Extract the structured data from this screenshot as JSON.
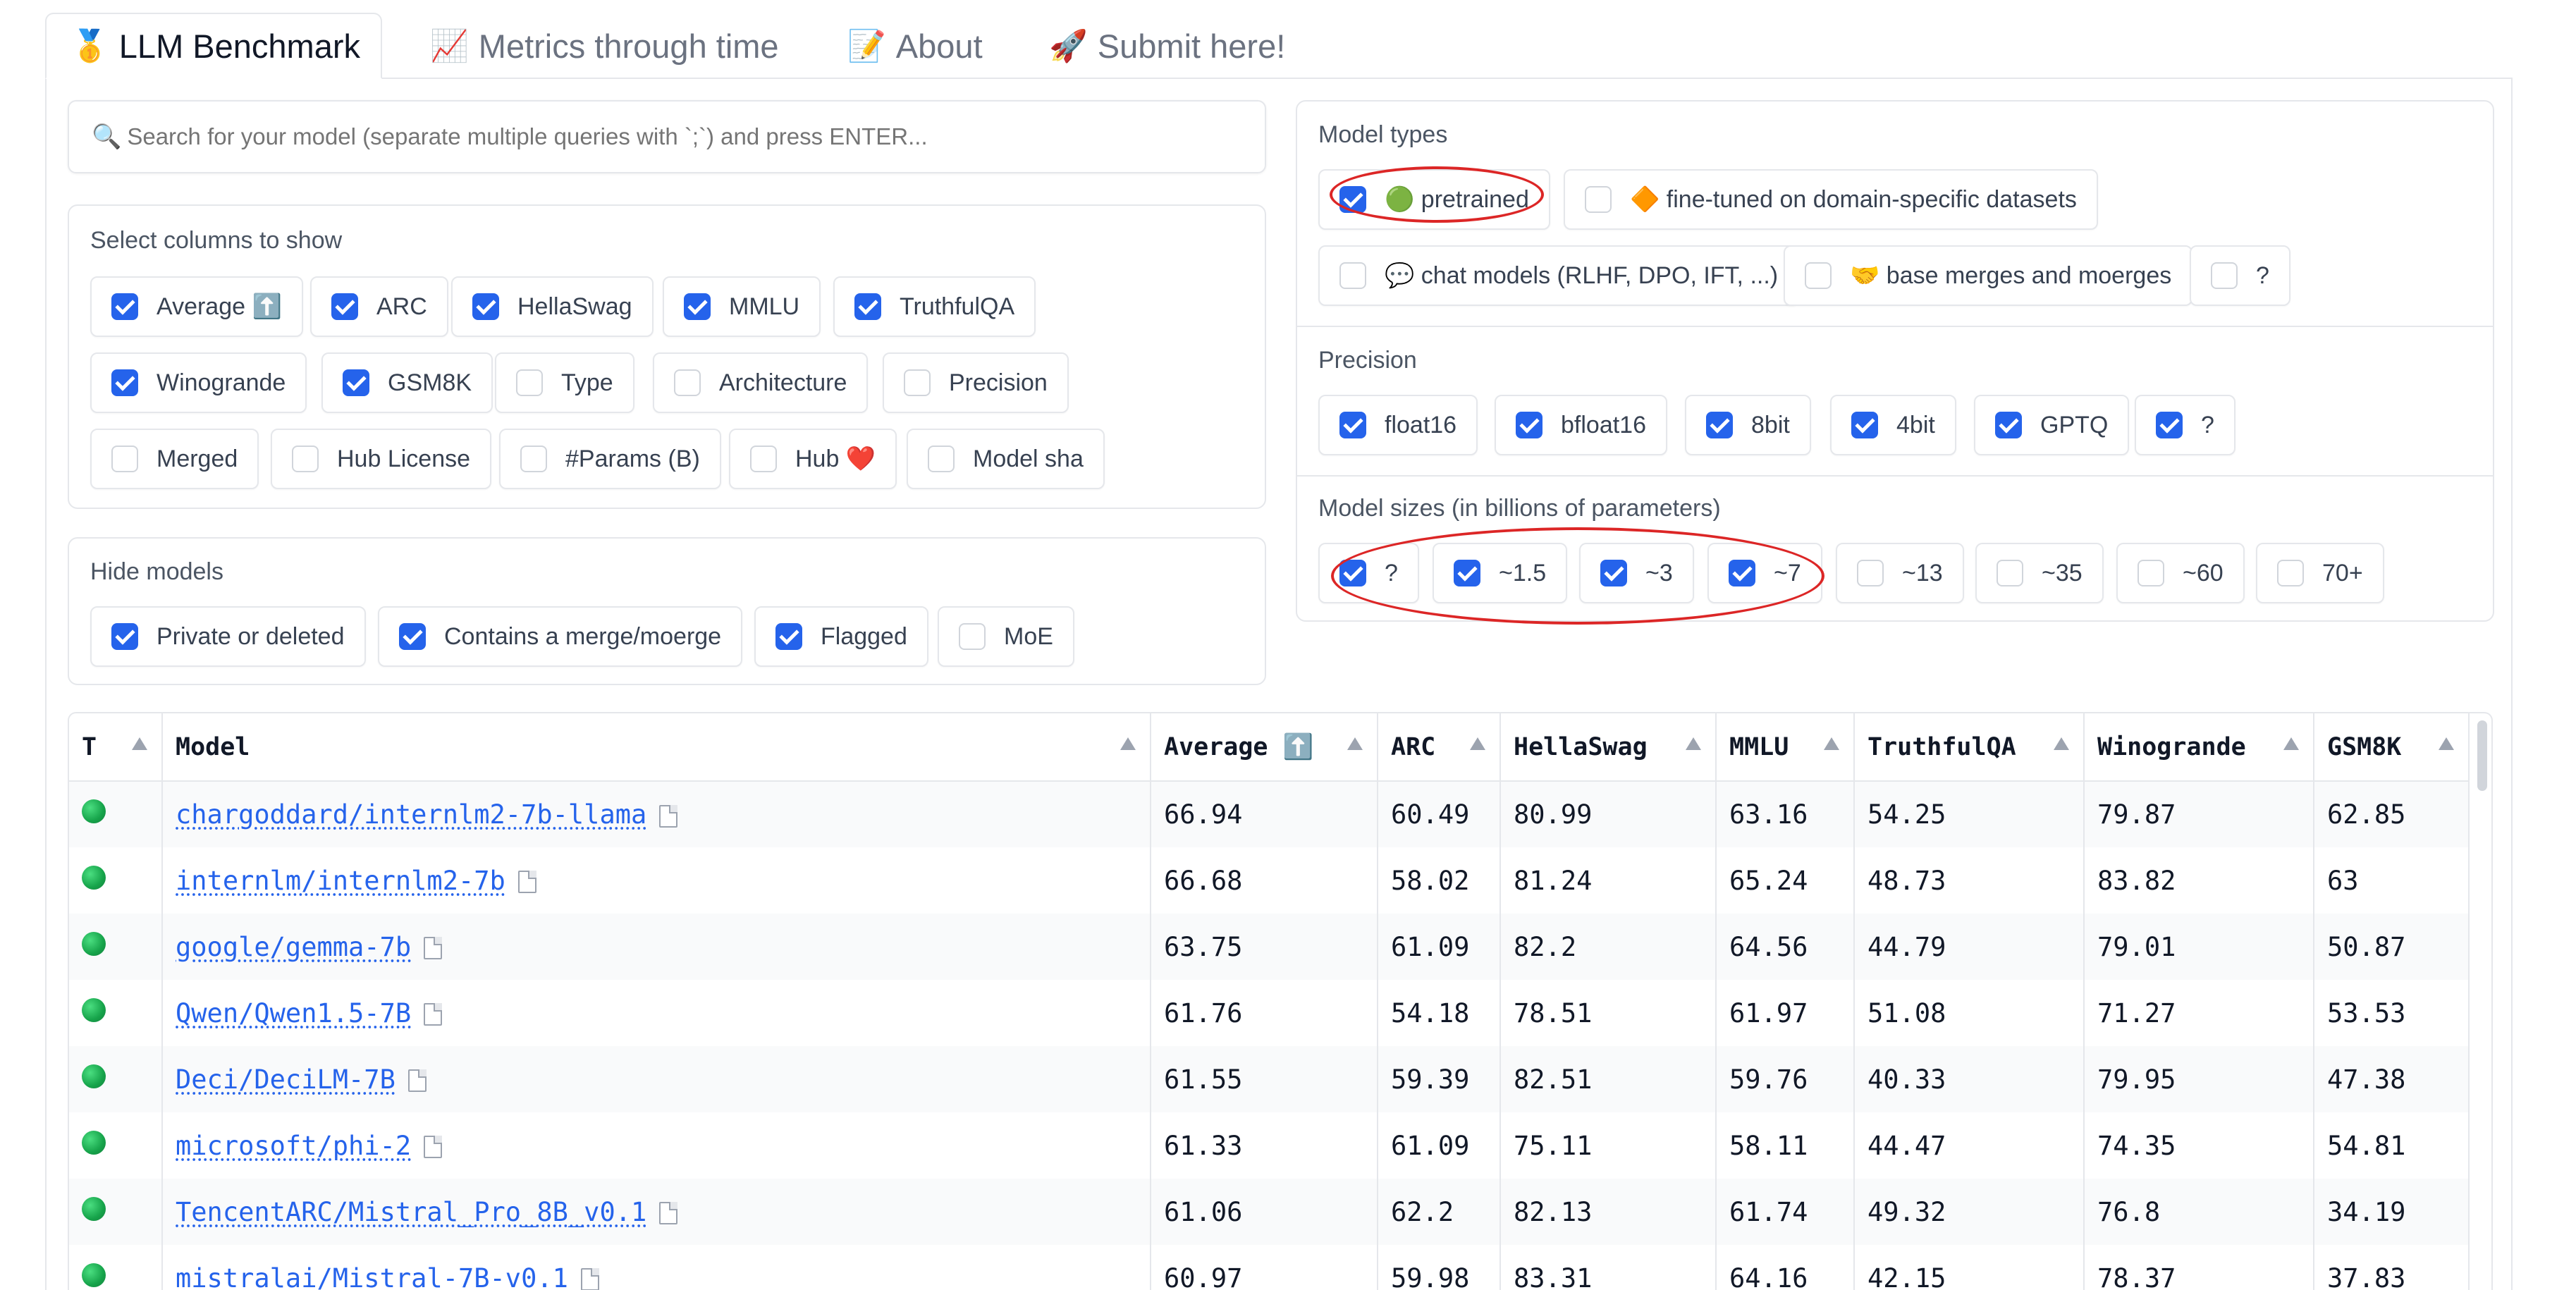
{
  "tabs": [
    {
      "icon": "🥇",
      "label": "LLM Benchmark"
    },
    {
      "icon": "📈",
      "label": "Metrics through time"
    },
    {
      "icon": "📝",
      "label": "About"
    },
    {
      "icon": "🚀",
      "label": "Submit here!"
    }
  ],
  "search": {
    "icon": "🔍",
    "placeholder": "Search for your model (separate multiple queries with `;`) and press ENTER..."
  },
  "columns_panel": {
    "label": "Select columns to show",
    "options": [
      {
        "label": "Average ⬆️",
        "checked": true
      },
      {
        "label": "ARC",
        "checked": true
      },
      {
        "label": "HellaSwag",
        "checked": true
      },
      {
        "label": "MMLU",
        "checked": true
      },
      {
        "label": "TruthfulQA",
        "checked": true
      },
      {
        "label": "Winogrande",
        "checked": true
      },
      {
        "label": "GSM8K",
        "checked": true
      },
      {
        "label": "Type",
        "checked": false
      },
      {
        "label": "Architecture",
        "checked": false
      },
      {
        "label": "Precision",
        "checked": false
      },
      {
        "label": "Merged",
        "checked": false
      },
      {
        "label": "Hub License",
        "checked": false
      },
      {
        "label": "#Params (B)",
        "checked": false
      },
      {
        "label": "Hub ❤️",
        "checked": false
      },
      {
        "label": "Model sha",
        "checked": false
      }
    ]
  },
  "hide_panel": {
    "label": "Hide models",
    "options": [
      {
        "label": "Private or deleted",
        "checked": true
      },
      {
        "label": "Contains a merge/moerge",
        "checked": true
      },
      {
        "label": "Flagged",
        "checked": true
      },
      {
        "label": "MoE",
        "checked": false
      }
    ]
  },
  "model_types": {
    "label": "Model types",
    "options": [
      {
        "label": "🟢 pretrained",
        "checked": true
      },
      {
        "label": "🔶 fine-tuned on domain-specific datasets",
        "checked": false
      },
      {
        "label": "💬 chat models (RLHF, DPO, IFT, ...)",
        "checked": false
      },
      {
        "label": "🤝 base merges and moerges",
        "checked": false
      },
      {
        "label": "?",
        "checked": false
      }
    ]
  },
  "precision": {
    "label": "Precision",
    "options": [
      {
        "label": "float16",
        "checked": true
      },
      {
        "label": "bfloat16",
        "checked": true
      },
      {
        "label": "8bit",
        "checked": true
      },
      {
        "label": "4bit",
        "checked": true
      },
      {
        "label": "GPTQ",
        "checked": true
      },
      {
        "label": "?",
        "checked": true
      }
    ]
  },
  "model_sizes": {
    "label": "Model sizes (in billions of parameters)",
    "options": [
      {
        "label": "?",
        "checked": true
      },
      {
        "label": "~1.5",
        "checked": true
      },
      {
        "label": "~3",
        "checked": true
      },
      {
        "label": "~7",
        "checked": true
      },
      {
        "label": "~13",
        "checked": false
      },
      {
        "label": "~35",
        "checked": false
      },
      {
        "label": "~60",
        "checked": false
      },
      {
        "label": "70+",
        "checked": false
      }
    ]
  },
  "table": {
    "headers": [
      "T",
      "Model",
      "Average ⬆️",
      "ARC",
      "HellaSwag",
      "MMLU",
      "TruthfulQA",
      "Winogrande",
      "GSM8K"
    ],
    "rows": [
      {
        "model": "chargoddard/internlm2-7b-llama",
        "average": "66.94",
        "arc": "60.49",
        "hellaswag": "80.99",
        "mmlu": "63.16",
        "truthfulqa": "54.25",
        "winogrande": "79.87",
        "gsm8k": "62.85"
      },
      {
        "model": "internlm/internlm2-7b",
        "average": "66.68",
        "arc": "58.02",
        "hellaswag": "81.24",
        "mmlu": "65.24",
        "truthfulqa": "48.73",
        "winogrande": "83.82",
        "gsm8k": "63"
      },
      {
        "model": "google/gemma-7b",
        "average": "63.75",
        "arc": "61.09",
        "hellaswag": "82.2",
        "mmlu": "64.56",
        "truthfulqa": "44.79",
        "winogrande": "79.01",
        "gsm8k": "50.87"
      },
      {
        "model": "Qwen/Qwen1.5-7B",
        "average": "61.76",
        "arc": "54.18",
        "hellaswag": "78.51",
        "mmlu": "61.97",
        "truthfulqa": "51.08",
        "winogrande": "71.27",
        "gsm8k": "53.53"
      },
      {
        "model": "Deci/DeciLM-7B",
        "average": "61.55",
        "arc": "59.39",
        "hellaswag": "82.51",
        "mmlu": "59.76",
        "truthfulqa": "40.33",
        "winogrande": "79.95",
        "gsm8k": "47.38"
      },
      {
        "model": "microsoft/phi-2",
        "average": "61.33",
        "arc": "61.09",
        "hellaswag": "75.11",
        "mmlu": "58.11",
        "truthfulqa": "44.47",
        "winogrande": "74.35",
        "gsm8k": "54.81"
      },
      {
        "model": "TencentARC/Mistral_Pro_8B_v0.1",
        "average": "61.06",
        "arc": "62.2",
        "hellaswag": "82.13",
        "mmlu": "61.74",
        "truthfulqa": "49.32",
        "winogrande": "76.8",
        "gsm8k": "34.19"
      },
      {
        "model": "mistralai/Mistral-7B-v0.1",
        "average": "60.97",
        "arc": "59.98",
        "hellaswag": "83.31",
        "mmlu": "64.16",
        "truthfulqa": "42.15",
        "winogrande": "78.37",
        "gsm8k": "37.83"
      }
    ]
  },
  "colors": {
    "accent": "#2563eb",
    "annotation": "#dc2626",
    "type_dot": "#16a34a"
  }
}
